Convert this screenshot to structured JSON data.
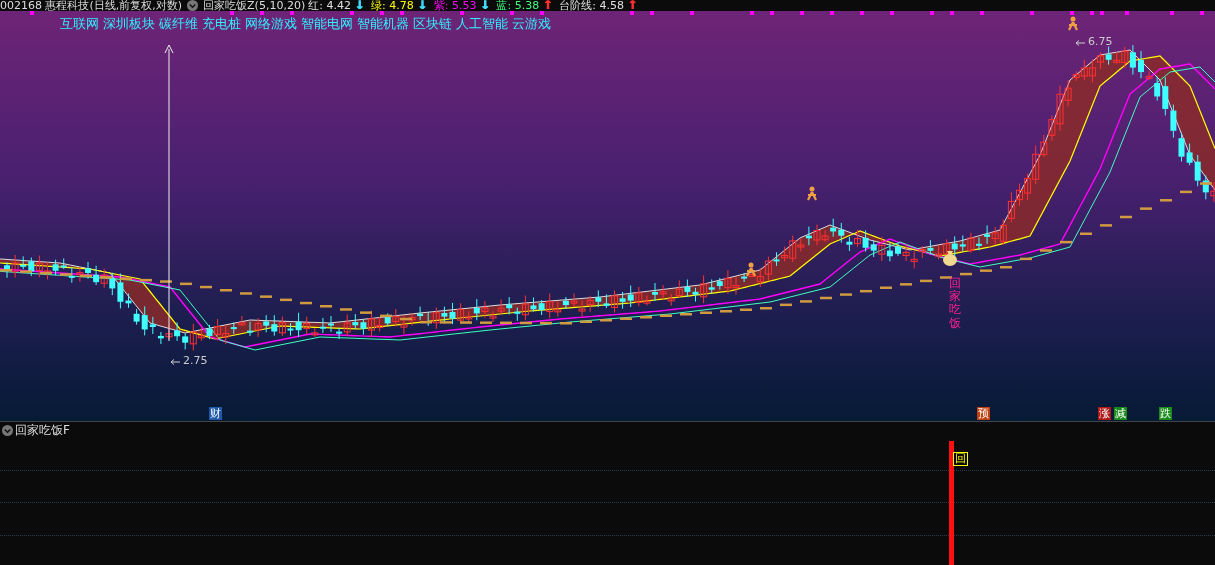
{
  "header": {
    "stock": "002168 惠程科技(日线,前复权,对数)",
    "indicator": "回家吃饭Z(5,10,20)",
    "readings": [
      {
        "kind": "reading",
        "text": "红: 4.42",
        "color": "#e0e0e0"
      },
      {
        "kind": "arrow",
        "text": "↓",
        "color": "#40e0ff"
      },
      {
        "kind": "reading",
        "text": "绿: 4.78",
        "color": "#ffff00"
      },
      {
        "kind": "arrow",
        "text": "↓",
        "color": "#40e0ff"
      },
      {
        "kind": "reading",
        "text": "紫: 5.53",
        "color": "#ff00ff"
      },
      {
        "kind": "arrow",
        "text": "↓",
        "color": "#40e0ff"
      },
      {
        "kind": "reading",
        "text": "蓝: 5.38",
        "color": "#40ff80"
      },
      {
        "kind": "arrow",
        "text": "↑",
        "color": "#ff3030"
      },
      {
        "kind": "reading",
        "text": "台阶线: 4.58",
        "color": "#e0e0e0"
      },
      {
        "kind": "arrow",
        "text": "↑",
        "color": "#ff3030"
      }
    ]
  },
  "concepts": [
    "互联网",
    "深圳板块",
    "碳纤维",
    "充电桩",
    "网络游戏",
    "智能电网",
    "智能机器",
    "区块链",
    "人工智能",
    "云游戏"
  ],
  "chart": {
    "high_label": "6.75",
    "low_label": "2.75",
    "signal_text": "回家吃饭",
    "markers": [
      {
        "text": "财",
        "color": "#1f5aa8"
      },
      {
        "text": "预",
        "color": "#c04010"
      },
      {
        "text": "涨",
        "color": "#b01818"
      },
      {
        "text": "减",
        "color": "#1a8a1a"
      },
      {
        "text": "跌",
        "color": "#1a8a1a"
      }
    ]
  },
  "subpanel": {
    "title": "回家吃饭F",
    "signal": "回"
  }
}
